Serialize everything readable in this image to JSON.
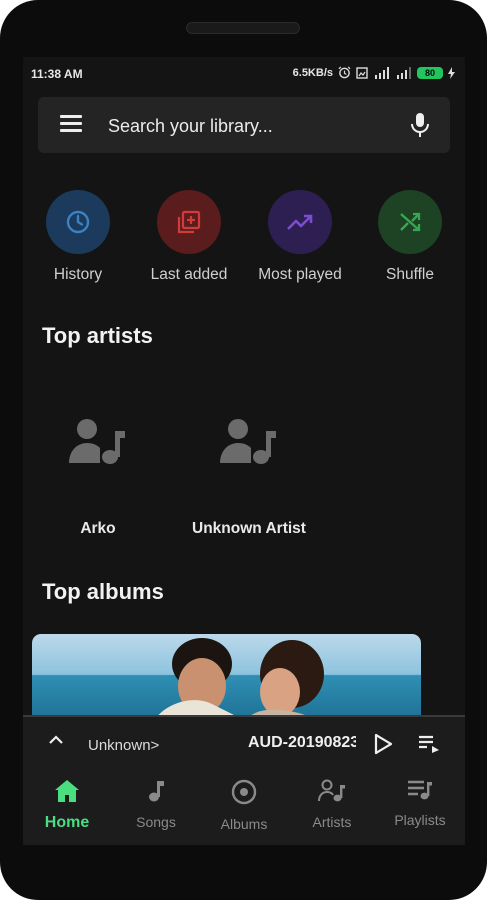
{
  "status_bar": {
    "time": "11:38 AM",
    "net_speed": "6.5KB/s",
    "battery": "80"
  },
  "search": {
    "placeholder": "Search your library..."
  },
  "quick_actions": [
    {
      "label": "History",
      "icon": "clock-icon",
      "bg": "#1b3a5c",
      "fg": "#3b82c4"
    },
    {
      "label": "Last added",
      "icon": "library-add-icon",
      "bg": "#5a1c1c",
      "fg": "#d13b3b"
    },
    {
      "label": "Most played",
      "icon": "trending-up-icon",
      "bg": "#2e1f52",
      "fg": "#7c4dd1"
    },
    {
      "label": "Shuffle",
      "icon": "shuffle-icon",
      "bg": "#1d4224",
      "fg": "#37a852"
    }
  ],
  "top_artists": {
    "title": "Top artists",
    "items": [
      {
        "name": "Arko",
        "icon": "artist-placeholder-icon"
      },
      {
        "name": "Unknown Artist",
        "icon": "artist-placeholder-icon"
      }
    ]
  },
  "top_albums": {
    "title": "Top albums"
  },
  "now_playing": {
    "artist": "Unknown>",
    "title": "AUD-20190823"
  },
  "bottom_nav": [
    {
      "label": "Home",
      "icon": "home-icon",
      "active": true
    },
    {
      "label": "Songs",
      "icon": "music-note-icon",
      "active": false
    },
    {
      "label": "Albums",
      "icon": "album-icon",
      "active": false
    },
    {
      "label": "Artists",
      "icon": "artists-icon",
      "active": false
    },
    {
      "label": "Playlists",
      "icon": "playlist-icon",
      "active": false
    }
  ],
  "colors": {
    "background": "#141414",
    "accent": "#4ade80",
    "battery": "#22c55e"
  }
}
